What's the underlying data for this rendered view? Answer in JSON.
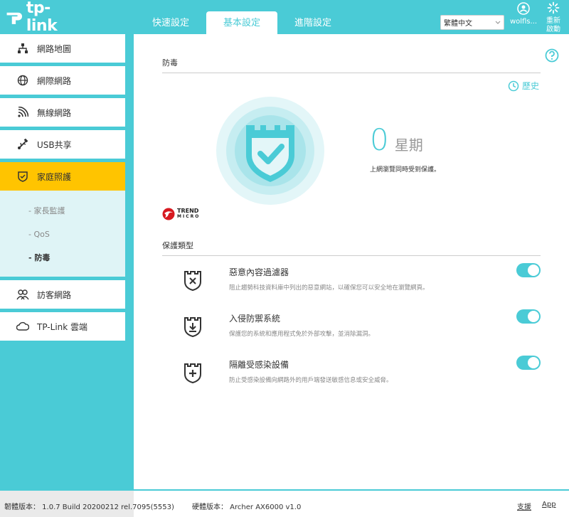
{
  "brand": {
    "logo_text": "tp-link"
  },
  "header": {
    "tabs": [
      {
        "label": "快速設定",
        "active": false
      },
      {
        "label": "基本設定",
        "active": true
      },
      {
        "label": "進階設定",
        "active": false
      }
    ],
    "language": "繁體中文",
    "user": "wolfls...",
    "reboot_label": "重新啟動"
  },
  "sidebar": {
    "items": [
      {
        "label": "網路地圖",
        "icon": "network-map-icon"
      },
      {
        "label": "網際網路",
        "icon": "globe-icon"
      },
      {
        "label": "無線網路",
        "icon": "wifi-icon"
      },
      {
        "label": "USB共享",
        "icon": "usb-icon"
      },
      {
        "label": "家庭照護",
        "icon": "shield-icon",
        "active": true
      },
      {
        "label": "訪客網路",
        "icon": "guests-icon"
      },
      {
        "label": "TP-Link 雲端",
        "icon": "cloud-icon"
      }
    ],
    "subitems": [
      {
        "label": "- 家長監護"
      },
      {
        "label": "- QoS"
      },
      {
        "label": "- 防毒",
        "active": true
      }
    ]
  },
  "main": {
    "section_title": "防毒",
    "history_label": "歷史",
    "stat_value": "0",
    "stat_unit": "星期",
    "stat_desc": "上網瀏覽同時受到保護。",
    "trend_line1": "TREND",
    "trend_line2": "MICRO",
    "protection_title": "保護類型",
    "protections": [
      {
        "title": "惡意內容過濾器",
        "desc": "阻止趨勢科技資料庫中列出的惡意網站，以確保您可以安全地在瀏覽網頁。",
        "enabled": true
      },
      {
        "title": "入侵防禦系統",
        "desc": "保護您的系統和應用程式免於外部攻擊，並消除漏洞。",
        "enabled": true
      },
      {
        "title": "隔離受感染設備",
        "desc": "防止受感染設備向網路外的用戶端發送敏感信息或安全威脅。",
        "enabled": true
      }
    ]
  },
  "footer": {
    "firmware": "韌體版本： 1.0.7 Build 20200212 rel.7095(5553)",
    "hardware": "硬體版本： Archer AX6000 v1.0",
    "support": "支援",
    "app": "App"
  },
  "colors": {
    "accent": "#4acbd6",
    "active_nav": "#ffc400"
  }
}
